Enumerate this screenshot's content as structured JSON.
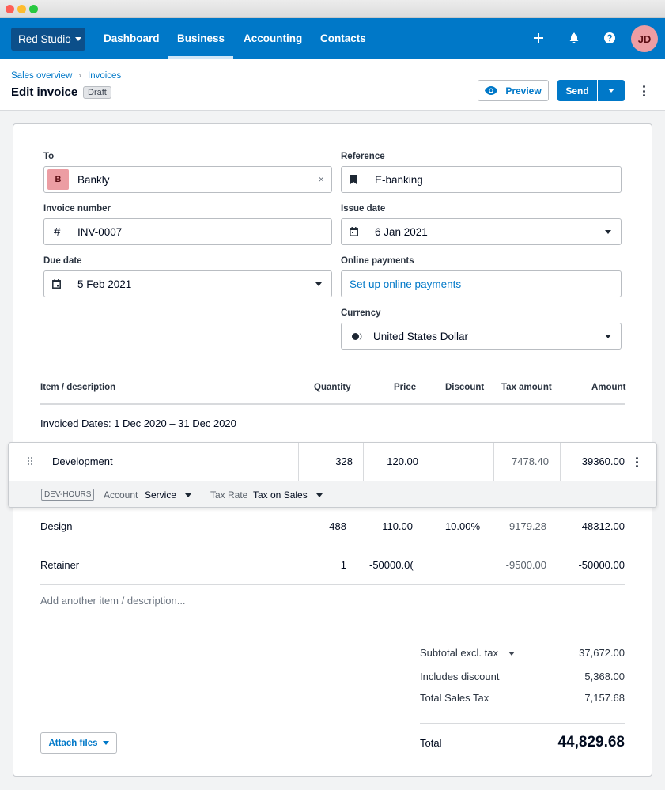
{
  "window": {
    "controls": [
      "close",
      "minimize",
      "zoom"
    ]
  },
  "nav": {
    "org_label": "Red Studio",
    "links": [
      {
        "label": "Dashboard",
        "active": false
      },
      {
        "label": "Business",
        "active": true
      },
      {
        "label": "Accounting",
        "active": false
      },
      {
        "label": "Contacts",
        "active": false
      }
    ],
    "icons": [
      "plus-icon",
      "bell-icon",
      "help-icon"
    ],
    "avatar_initials": "JD",
    "colors": {
      "bar": "#0078c8",
      "org": "#0c4f8a",
      "avatar": "#ec9da3"
    }
  },
  "header": {
    "breadcrumb": [
      {
        "label": "Sales overview"
      },
      {
        "label": "Invoices"
      }
    ],
    "title": "Edit invoice",
    "status_badge": "Draft",
    "preview_label": "Preview",
    "send_label": "Send"
  },
  "form": {
    "to": {
      "label": "To",
      "contact_initial": "B",
      "value": "Bankly",
      "clear": "×"
    },
    "reference": {
      "label": "Reference",
      "value": "E-banking"
    },
    "invoice_number": {
      "label": "Invoice number",
      "prefix": "#",
      "value": "INV-0007"
    },
    "issue_date": {
      "label": "Issue date",
      "value": "6 Jan 2021"
    },
    "due_date": {
      "label": "Due date",
      "value": "5 Feb 2021"
    },
    "online_payments": {
      "label": "Online payments",
      "link": "Set up online payments"
    },
    "currency": {
      "label": "Currency",
      "value": "United States Dollar"
    }
  },
  "table": {
    "headers": {
      "item": "Item / description",
      "quantity": "Quantity",
      "price": "Price",
      "discount": "Discount",
      "tax": "Tax amount",
      "amount": "Amount"
    },
    "note": "Invoiced Dates: 1 Dec 2020 – 31 Dec 2020",
    "rows": [
      {
        "item": "Development",
        "quantity": "328",
        "price": "120.00",
        "discount": "",
        "tax": "7478.40",
        "amount": "39360.00",
        "code": "DEV-HOURS",
        "account_label": "Account",
        "account": "Service",
        "tax_rate_label": "Tax Rate",
        "tax_rate": "Tax on Sales"
      },
      {
        "item": "Design",
        "quantity": "488",
        "price": "110.00",
        "discount": "10.00%",
        "tax": "9179.28",
        "amount": "48312.00"
      },
      {
        "item": "Retainer",
        "quantity": "1",
        "price": "-50000.0(",
        "discount": "",
        "tax": "-9500.00",
        "amount": "-50000.00"
      }
    ],
    "add_placeholder": "Add another item / description..."
  },
  "totals": {
    "subtotal_label": "Subtotal excl. tax",
    "subtotal": "37,672.00",
    "discount_label": "Includes discount",
    "discount": "5,368.00",
    "tax_label": "Total Sales Tax",
    "tax": "7,157.68",
    "total_label": "Total",
    "total": "44,829.68"
  },
  "attach_label": "Attach files"
}
